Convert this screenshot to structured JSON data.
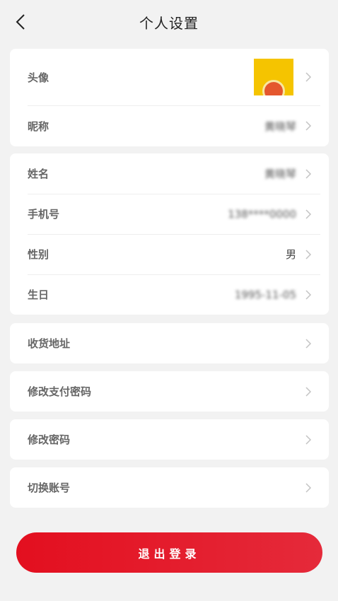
{
  "header": {
    "title": "个人设置",
    "back_icon": "chevron-left-icon"
  },
  "card1": {
    "avatar_label": "头像",
    "nickname_label": "昵称",
    "nickname_value": "黄晓琴"
  },
  "card2": {
    "name_label": "姓名",
    "name_value": "黄晓琴",
    "phone_label": "手机号",
    "phone_value": "138****0000",
    "gender_label": "性别",
    "gender_value": "男",
    "birthday_label": "生日",
    "birthday_value": "1995-11-05"
  },
  "address_label": "收货地址",
  "pay_password_label": "修改支付密码",
  "password_label": "修改密码",
  "switch_account_label": "切换账号",
  "logout_label": "退出登录",
  "colors": {
    "accent": "#e30f1f",
    "avatar_bg": "#f5c400"
  }
}
